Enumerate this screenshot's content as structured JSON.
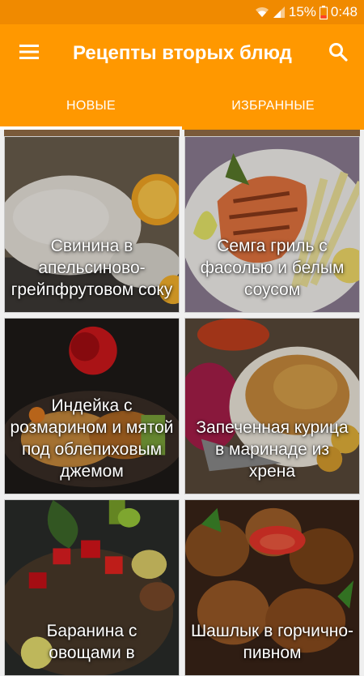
{
  "status_bar": {
    "battery_percent": "15%",
    "time": "0:48",
    "icons": [
      "wifi-icon",
      "signal-icon",
      "battery-low-icon"
    ]
  },
  "app_bar": {
    "title": "Рецепты вторых блюд",
    "icons": [
      "menu-icon",
      "search-icon"
    ]
  },
  "tabs": [
    {
      "label": "НОВЫЕ",
      "active": true
    },
    {
      "label": "ИЗБРАННЫЕ",
      "active": false
    }
  ],
  "colors": {
    "status_bar": "#f08a00",
    "app_bar": "#ff9800",
    "tab_indicator": "#ffffff"
  },
  "recipes": [
    {
      "title": "Свинина в апельсиново-грейпфрутовом соку"
    },
    {
      "title": "Семга гриль с фасолью и белым соусом"
    },
    {
      "title": "Индейка с розмарином и мятой под облепиховым джемом"
    },
    {
      "title": "Запеченная курица в маринаде из хрена"
    },
    {
      "title": "Баранина с овощами в"
    },
    {
      "title": "Шашлык в горчично-пивном"
    }
  ]
}
